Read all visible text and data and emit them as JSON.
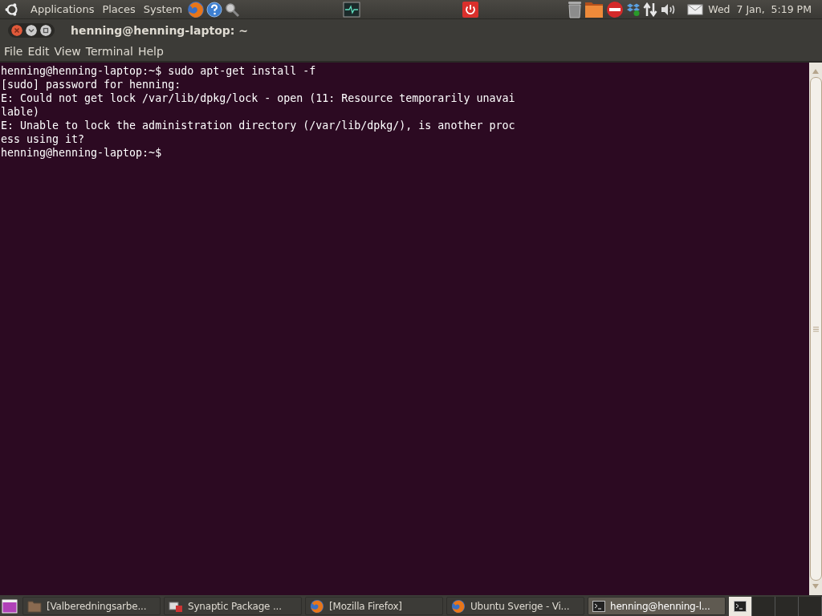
{
  "top_panel": {
    "menus": [
      "Applications",
      "Places",
      "System"
    ],
    "clock": "Wed  7 Jan,  5:19 PM"
  },
  "window": {
    "title": "henning@henning-laptop: ~",
    "menu": [
      "File",
      "Edit",
      "View",
      "Terminal",
      "Help"
    ]
  },
  "terminal": {
    "lines": [
      "henning@henning-laptop:~$ sudo apt-get install -f",
      "[sudo] password for henning:",
      "E: Could not get lock /var/lib/dpkg/lock - open (11: Resource temporarily unavai",
      "lable)",
      "E: Unable to lock the administration directory (/var/lib/dpkg/), is another proc",
      "ess using it?",
      "henning@henning-laptop:~$"
    ]
  },
  "taskbar": {
    "items": [
      {
        "kind": "folder",
        "label": "[Valberedningsarbe...",
        "selected": false
      },
      {
        "kind": "package",
        "label": "Synaptic Package ...",
        "selected": false
      },
      {
        "kind": "browser",
        "label": "[Mozilla Firefox]",
        "selected": false
      },
      {
        "kind": "browser",
        "label": "Ubuntu Sverige - Vi...",
        "selected": false
      },
      {
        "kind": "terminal",
        "label": "henning@henning-l...",
        "selected": true
      }
    ],
    "workspaces": [
      {
        "selected": true
      },
      {
        "selected": false
      },
      {
        "selected": false
      },
      {
        "selected": false
      }
    ]
  }
}
